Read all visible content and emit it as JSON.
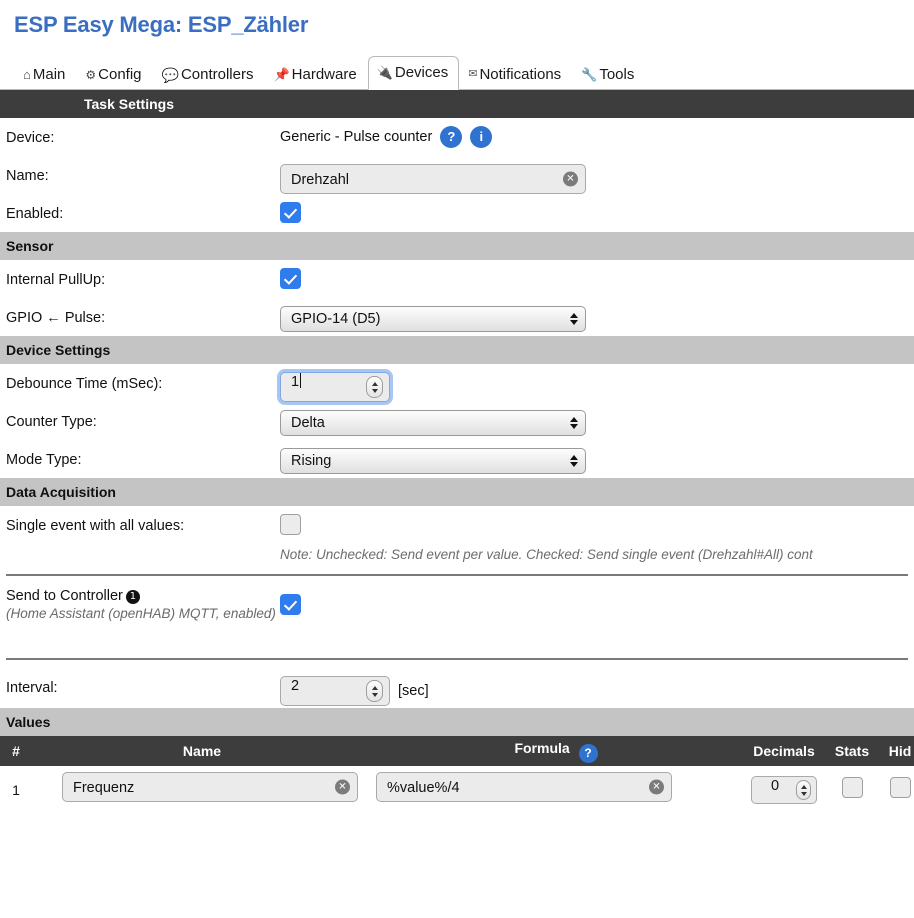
{
  "header": {
    "title": "ESP Easy Mega: ESP_Zähler"
  },
  "tabs": [
    {
      "label": "Main",
      "icon": "home-icon",
      "active": false
    },
    {
      "label": "Config",
      "icon": "gear-icon",
      "active": false
    },
    {
      "label": "Controllers",
      "icon": "bubble-icon",
      "active": false
    },
    {
      "label": "Hardware",
      "icon": "pin-icon",
      "active": false
    },
    {
      "label": "Devices",
      "icon": "plug-icon",
      "active": true
    },
    {
      "label": "Notifications",
      "icon": "mail-icon",
      "active": false
    },
    {
      "label": "Tools",
      "icon": "wrench-icon",
      "active": false
    }
  ],
  "sections": {
    "task_settings": "Task Settings",
    "sensor": "Sensor",
    "device_settings": "Device Settings",
    "data_acquisition": "Data Acquisition",
    "values": "Values"
  },
  "task": {
    "device_label": "Device:",
    "device_value": "Generic - Pulse counter",
    "help_badge": "?",
    "info_badge": "i",
    "name_label": "Name:",
    "name_value": "Drehzahl",
    "enabled_label": "Enabled:",
    "enabled_checked": true
  },
  "sensor": {
    "pullup_label": "Internal PullUp:",
    "pullup_checked": true,
    "gpio_label": "GPIO ← Pulse:",
    "gpio_value": "GPIO-14 (D5)"
  },
  "device_settings": {
    "debounce_label": "Debounce Time (mSec):",
    "debounce_value": "1",
    "counter_label": "Counter Type:",
    "counter_value": "Delta",
    "mode_label": "Mode Type:",
    "mode_value": "Rising"
  },
  "data_acquisition": {
    "single_event_label": "Single event with all values:",
    "single_event_checked": false,
    "note": "Note: Unchecked: Send event per value. Checked: Send single event (Drehzahl#All) cont",
    "send_controller_label": "Send to Controller",
    "send_controller_badge": "1",
    "send_controller_sub": "(Home Assistant (openHAB) MQTT, enabled)",
    "send_controller_checked": true,
    "interval_label": "Interval:",
    "interval_value": "2",
    "interval_unit": "[sec]"
  },
  "values_table": {
    "columns": {
      "index": "#",
      "name": "Name",
      "formula": "Formula",
      "formula_badge": "?",
      "decimals": "Decimals",
      "stats": "Stats",
      "hide": "Hid"
    },
    "rows": [
      {
        "index": "1",
        "name": "Frequenz",
        "formula": "%value%/4",
        "decimals": "0",
        "stats_checked": false,
        "hide_checked": false
      }
    ]
  },
  "colors": {
    "title_blue": "#3a6ec0",
    "dark_header": "#3d3d3d",
    "gray_header": "#c4c4c4",
    "accent_blue": "#2f7ced",
    "badge_blue": "#2f72d0"
  }
}
